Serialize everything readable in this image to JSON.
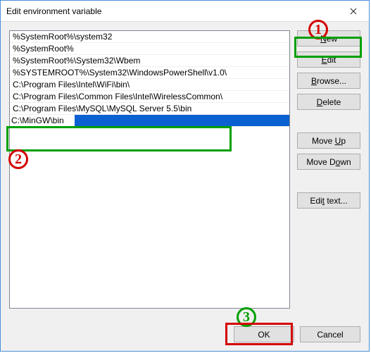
{
  "title": "Edit environment variable",
  "list": {
    "items": [
      "%SystemRoot%\\system32",
      "%SystemRoot%",
      "%SystemRoot%\\System32\\Wbem",
      "%SYSTEMROOT%\\System32\\WindowsPowerShell\\v1.0\\",
      "C:\\Program Files\\Intel\\WiFi\\bin\\",
      "C:\\Program Files\\Common Files\\Intel\\WirelessCommon\\",
      "C:\\Program Files\\MySQL\\MySQL Server 5.5\\bin"
    ],
    "editing_value": "C:\\MinGW\\bin"
  },
  "buttons": {
    "new": "New",
    "edit": "Edit",
    "browse": "Browse...",
    "delete": "Delete",
    "move_up": "Move Up",
    "move_down": "Move Down",
    "edit_text": "Edit text...",
    "ok": "OK",
    "cancel": "Cancel"
  },
  "annotations": {
    "c1": "1",
    "c2": "2",
    "c3": "3"
  }
}
